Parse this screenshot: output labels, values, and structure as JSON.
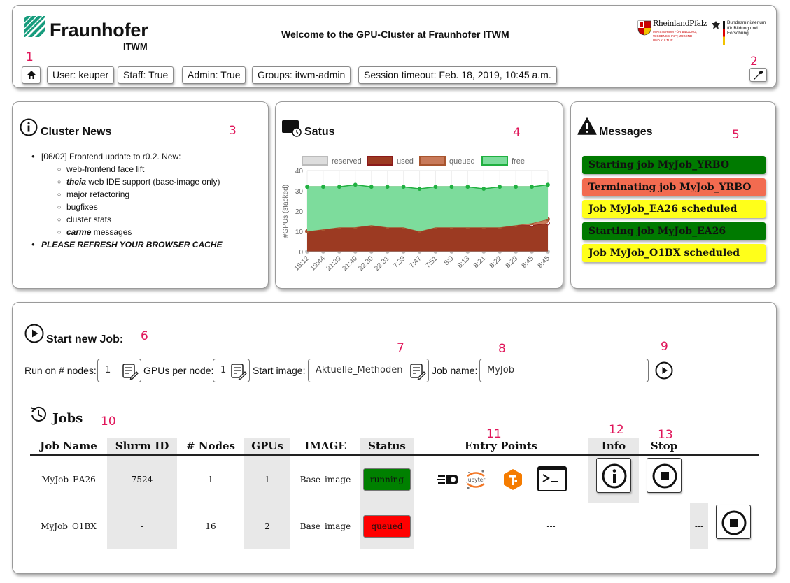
{
  "header": {
    "logo_name": "Fraunhofer",
    "logo_sub": "ITWM",
    "welcome": "Welcome to the GPU-Cluster at Fraunhofer ITWM",
    "sponsor1": "RheinlandPfalz",
    "sponsor1_sub": "MINISTERIUM FÜR BILDUNG, WISSENSCHAFT, JUGEND UND KULTUR",
    "sponsor2": "Bundesministerium für Bildung und Forschung",
    "user": "User: keuper",
    "staff": "Staff: True",
    "admin": "Admin: True",
    "groups": "Groups: itwm-admin",
    "session": "Session timeout: Feb. 18, 2019, 10:45 a.m.",
    "home_icon": "home-icon",
    "settings_icon": "wrench-icon"
  },
  "annotations": [
    "1",
    "2",
    "3",
    "4",
    "5",
    "6",
    "7",
    "8",
    "9",
    "10",
    "11",
    "12",
    "13"
  ],
  "news": {
    "title": "Cluster News",
    "item1": "[06/02] Frontend update to r0.2. New:",
    "sub": [
      {
        "em": "",
        "text": "web-frontend face lift"
      },
      {
        "em": "theia",
        "text": " web IDE support (base-image only)"
      },
      {
        "em": "",
        "text": "major refactoring"
      },
      {
        "em": "",
        "text": "bugfixes"
      },
      {
        "em": "",
        "text": "cluster stats"
      },
      {
        "em": "carme",
        "text": " messages"
      }
    ],
    "item2": "PLEASE REFRESH YOUR BROWSER CACHE"
  },
  "status": {
    "title": "Satus"
  },
  "chart_data": {
    "type": "area",
    "stacked": true,
    "categories": [
      "18:12",
      "19:44",
      "21:39",
      "21:40",
      "22:30",
      "22:31",
      "7:39",
      "7:47",
      "7:51",
      "8:9",
      "8:13",
      "8:21",
      "8:22",
      "8:29",
      "8:45",
      "8:45"
    ],
    "series": [
      {
        "name": "reserved",
        "color": "#dddddd",
        "values": [
          0,
          0,
          0,
          0,
          0,
          0,
          0,
          0,
          0,
          0,
          0,
          0,
          0,
          0,
          0,
          0
        ]
      },
      {
        "name": "used",
        "color": "#8b1a1a",
        "values": [
          10,
          11,
          12,
          12,
          13,
          12,
          12,
          10,
          12,
          12,
          12,
          12,
          12,
          13,
          13,
          14
        ]
      },
      {
        "name": "queued",
        "color": "#c87a5a",
        "values": [
          0,
          0,
          0,
          0,
          0,
          0,
          0,
          0,
          0,
          0,
          0,
          0,
          0,
          0,
          1,
          2
        ]
      },
      {
        "name": "free",
        "color": "#7ddc9c",
        "values": [
          22,
          21,
          20,
          21,
          19,
          20,
          20,
          21,
          20,
          20,
          20,
          19,
          20,
          19,
          18,
          17
        ]
      }
    ],
    "ylabel": "#GPUs (stacked)",
    "ylim": [
      0,
      40
    ],
    "yticks": [
      0,
      10,
      20,
      30,
      40
    ],
    "grid": true,
    "legend": "top"
  },
  "messages": {
    "title": "Messages",
    "items": [
      {
        "text": "Starting job MyJob_YRBO",
        "bg": "#007a00",
        "fg": "#111111"
      },
      {
        "text": "Terminating job MyJob_YRBO",
        "bg": "#f26b50",
        "fg": "#111111"
      },
      {
        "text": "Job MyJob_EA26 scheduled",
        "bg": "#ffff1a",
        "fg": "#111111"
      },
      {
        "text": "Starting job MyJob_EA26",
        "bg": "#007a00",
        "fg": "#111111"
      },
      {
        "text": "Job MyJob_O1BX scheduled",
        "bg": "#ffff1a",
        "fg": "#111111"
      }
    ]
  },
  "start": {
    "title": "Start new Job:",
    "nodes_label": "Run on # nodes:",
    "nodes_value": "1",
    "gpus_label": "GPUs per node:",
    "gpus_value": "1",
    "image_label": "Start image:",
    "image_value": "Aktuelle_Methoden",
    "name_label": "Job name:",
    "name_value": "MyJob"
  },
  "jobs": {
    "title": "Jobs",
    "headers": [
      "Job Name",
      "Slurm ID",
      "# Nodes",
      "GPUs",
      "IMAGE",
      "Status",
      "Entry Points",
      "Info",
      "Stop"
    ],
    "rows": [
      {
        "name": "MyJob_EA26",
        "slurm": "7524",
        "nodes": "1",
        "gpus": "1",
        "image": "Base_image",
        "status": "running",
        "status_color": "#008000"
      },
      {
        "name": "MyJob_O1BX",
        "slurm": "-",
        "nodes": "16",
        "gpus": "2",
        "image": "Base_image",
        "status": "queued",
        "status_color": "#ff0000",
        "entry": "---",
        "info": "---"
      }
    ],
    "entry_icons": [
      "speed-icon",
      "jupyter-icon",
      "tensorboard-icon",
      "terminal-icon"
    ],
    "jupyter_label": "jupyter"
  }
}
